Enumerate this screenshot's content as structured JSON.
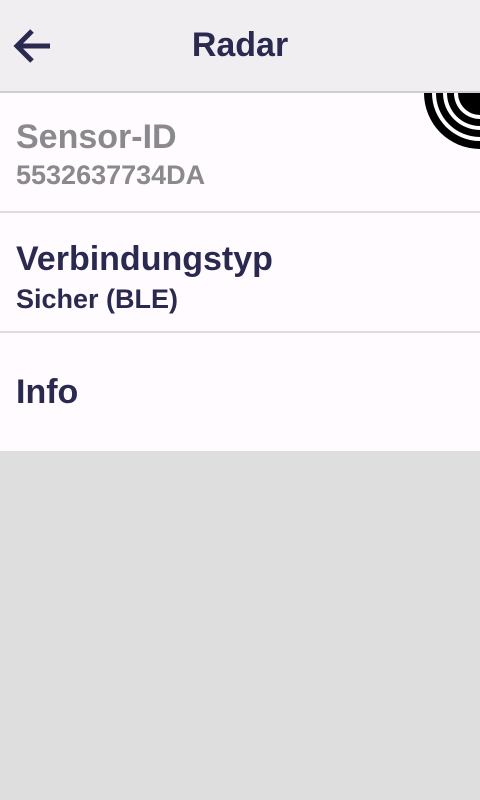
{
  "header": {
    "title": "Radar",
    "back_icon": "arrow-left-icon",
    "colors": {
      "bar_background": "#f0eef0",
      "title": "#2a2a50"
    }
  },
  "list": {
    "items": [
      {
        "title": "Sensor-ID",
        "subtitle": "5532637734DA",
        "enabled": false
      },
      {
        "title": "Verbindungstyp",
        "subtitle": "Sicher (BLE)",
        "enabled": true
      },
      {
        "title": "Info",
        "subtitle": "",
        "enabled": true
      }
    ],
    "badge_icon": "radar-signal-icon",
    "colors": {
      "background": "#fffbff",
      "disabled_text": "#8a8a8e",
      "text": "#2a2a50",
      "divider": "#dcdcdf"
    }
  },
  "screen": {
    "colors": {
      "empty_background": "#dedede"
    }
  }
}
